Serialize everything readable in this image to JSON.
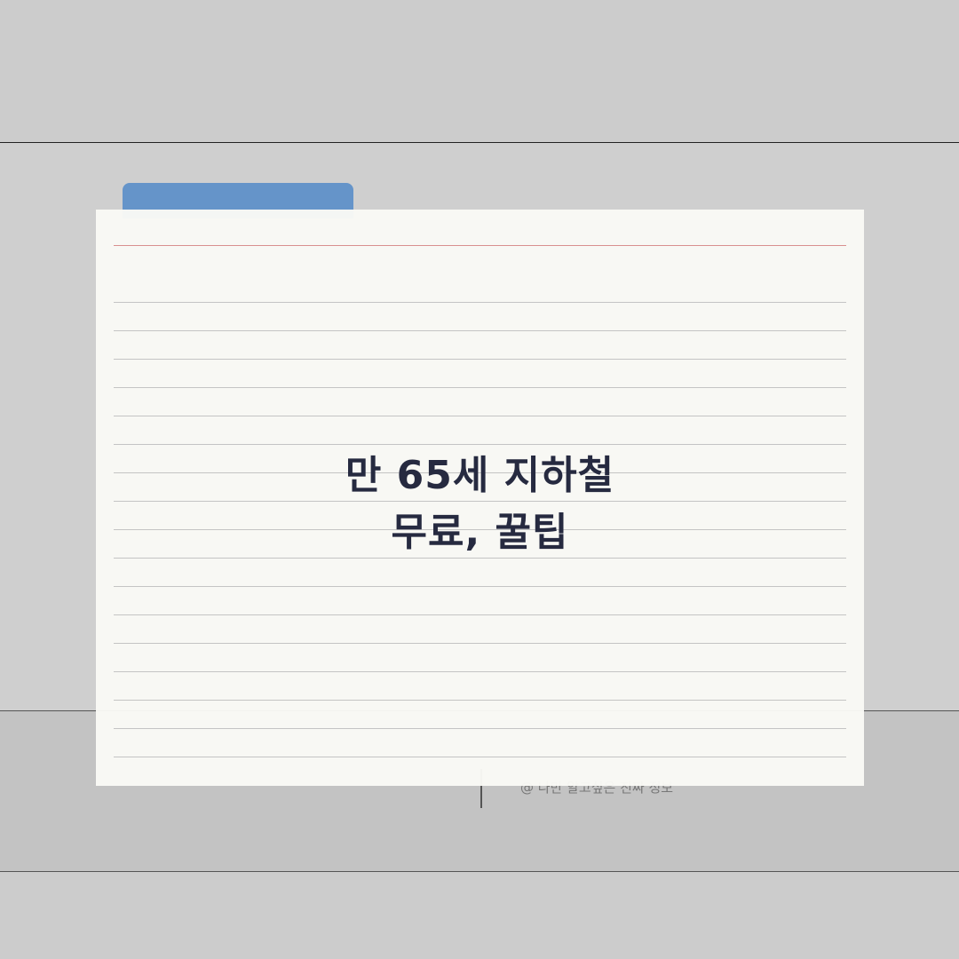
{
  "card": {
    "title_lines": [
      "만 65세 지하철",
      "무료, 꿀팁"
    ]
  },
  "footer": {
    "credit": "@ 나만 알고싶은 진짜 정보"
  },
  "colors": {
    "background": "#cccccc",
    "tab": "#6594c9",
    "card": "#fafaf6",
    "margin_line": "#d9908f",
    "rule_line": "#c4c4c4",
    "title_text": "#262a40"
  }
}
